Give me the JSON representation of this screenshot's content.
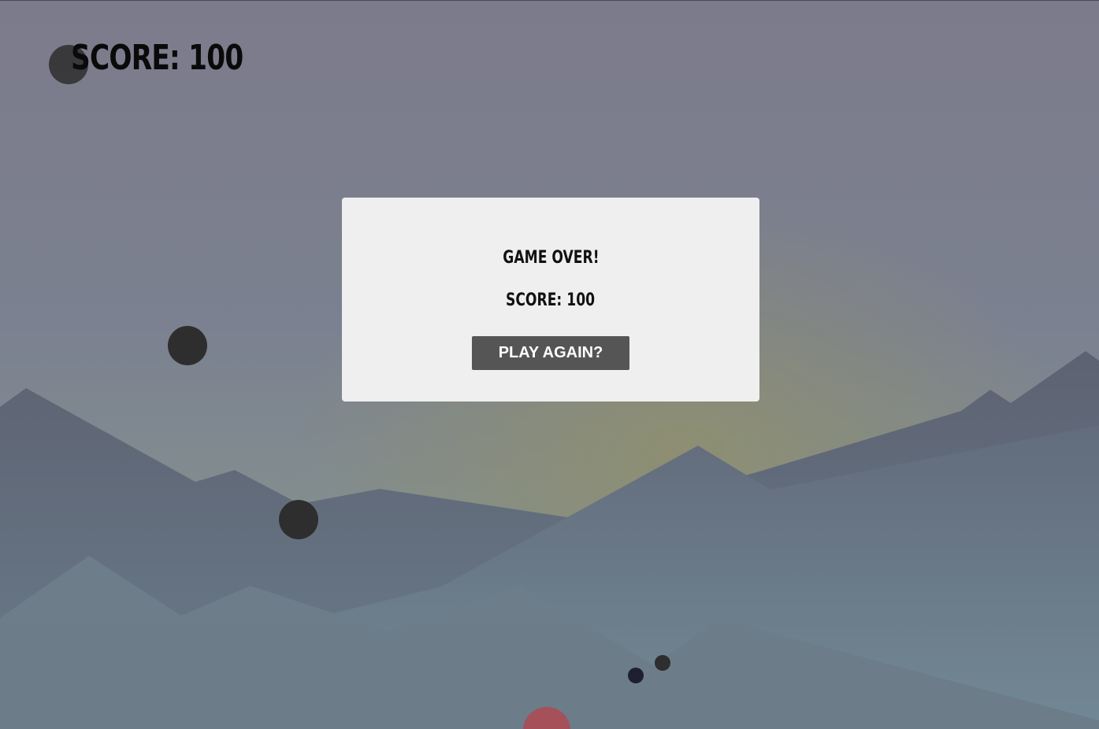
{
  "hud": {
    "score_text": "SCORE: 100"
  },
  "modal": {
    "title": "GAME OVER!",
    "score_text": "SCORE: 100",
    "button_label": "PLAY AGAIN?"
  },
  "colors": {
    "sky_top": "#7c7b8b",
    "sky_glow": "#8a8c74",
    "ball_dark": "#2e2e2e",
    "ball_navy": "#1e2030",
    "ball_red": "#a6505a",
    "modal_bg": "#efefef",
    "button_bg": "#555555"
  },
  "balls": [
    {
      "name": "ball-dark",
      "color": "#2e2e2e"
    },
    {
      "name": "ball-dark",
      "color": "#2e2e2e"
    },
    {
      "name": "ball-dark",
      "color": "#2e2e2e"
    },
    {
      "name": "ball-dark-small",
      "color": "#2e2e2e"
    },
    {
      "name": "ball-navy-small",
      "color": "#1e2030"
    },
    {
      "name": "player-ball-red",
      "color": "#a6505a"
    }
  ]
}
